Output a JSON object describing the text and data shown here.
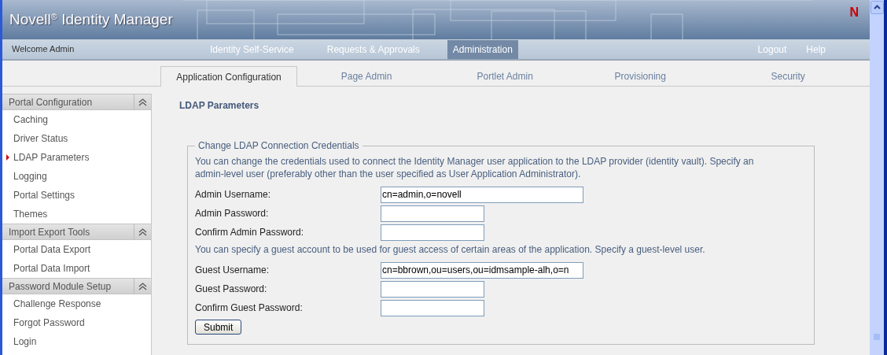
{
  "header": {
    "title": "Novell$^{®}$ Identity Manager",
    "logo": "N"
  },
  "nav": {
    "welcome": "Welcome Admin",
    "items": [
      {
        "label": "Identity Self-Service",
        "selected": false
      },
      {
        "label": "Requests & Approvals",
        "selected": false
      },
      {
        "label": "Administration",
        "selected": true
      }
    ],
    "links": [
      "Logout",
      "Help"
    ]
  },
  "tabs": [
    {
      "label": "Application Configuration",
      "selected": true
    },
    {
      "label": "Page Admin",
      "selected": false
    },
    {
      "label": "Portlet Admin",
      "selected": false
    },
    {
      "label": "Provisioning",
      "selected": false
    },
    {
      "label": "Security",
      "selected": false
    }
  ],
  "sidebar": {
    "sections": [
      {
        "title": "Portal Configuration",
        "expanded": true,
        "items": [
          {
            "label": "Caching",
            "selected": false
          },
          {
            "label": "Driver Status",
            "selected": false
          },
          {
            "label": "LDAP Parameters",
            "selected": true
          },
          {
            "label": "Logging",
            "selected": false
          },
          {
            "label": "Portal Settings",
            "selected": false
          },
          {
            "label": "Themes",
            "selected": false
          }
        ]
      },
      {
        "title": "Import Export Tools",
        "expanded": true,
        "items": [
          {
            "label": "Portal Data Export",
            "selected": false
          },
          {
            "label": "Portal Data Import",
            "selected": false
          }
        ]
      },
      {
        "title": "Password Module Setup",
        "expanded": true,
        "items": [
          {
            "label": "Challenge Response",
            "selected": false
          },
          {
            "label": "Forgot Password",
            "selected": false
          },
          {
            "label": "Login",
            "selected": false
          }
        ]
      }
    ]
  },
  "page": {
    "title": "LDAP Parameters",
    "fieldset": {
      "legend": "Change LDAP Connection Credentials",
      "rows": [
        {
          "kind": "note",
          "text": "You can change the credentials used to connect the Identity Manager user application to the LDAP provider (identity vault). Specify an admin-level user (preferably other than the user specified as User Application Administrator)."
        },
        {
          "kind": "text",
          "label": "Admin Username:",
          "value": "cn=admin,o=novell"
        },
        {
          "kind": "password",
          "label": "Admin Password:"
        },
        {
          "kind": "password",
          "label": "Confirm Admin Password:"
        },
        {
          "kind": "note",
          "text": "You can specify a guest account to be used for guest access of certain areas of the application. Specify a guest-level user."
        },
        {
          "kind": "text",
          "label": "Guest Username:",
          "value": "cn=bbrown,ou=users,ou=idmsample-alh,o=n"
        },
        {
          "kind": "password",
          "label": "Guest Password:"
        },
        {
          "kind": "password",
          "label": "Confirm Guest Password:"
        }
      ],
      "button": "Submit"
    }
  }
}
